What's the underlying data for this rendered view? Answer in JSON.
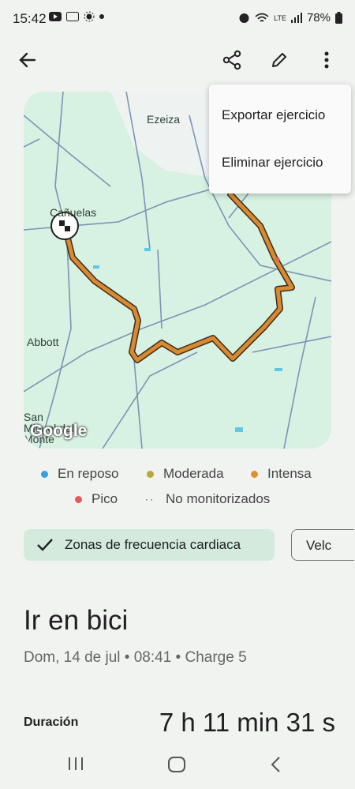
{
  "status": {
    "time": "15:42",
    "battery": "78%",
    "network": "LTE"
  },
  "menu": {
    "export": "Exportar ejercicio",
    "delete": "Eliminar ejercicio"
  },
  "map": {
    "labels": {
      "ezeiza": "Ezeiza",
      "canuelas": "Cañuelas",
      "abbott": "Abbott",
      "san_miguel": "San Miguel del Monte"
    },
    "google": "Google"
  },
  "legend": [
    {
      "label": "En reposo",
      "color": "#3aa0dc"
    },
    {
      "label": "Moderada",
      "color": "#b7a63a"
    },
    {
      "label": "Intensa",
      "color": "#e0902d"
    },
    {
      "label": "Pico",
      "color": "#e45a5a"
    },
    {
      "label": "No monitorizados",
      "color": "#333333"
    }
  ],
  "chips": {
    "heart_zones": "Zonas de frecuencia cardiaca",
    "speed": "Velc"
  },
  "activity": {
    "title": "Ir en bici",
    "subtitle": "Dom, 14 de jul • 08:41 • Charge 5",
    "duration_label": "Duración",
    "duration_value": "7 h 11 min 31 s"
  },
  "colors": {
    "route": "#d98a31",
    "map_bg": "#d7f1e2",
    "chip_bg": "#d3eadc"
  }
}
